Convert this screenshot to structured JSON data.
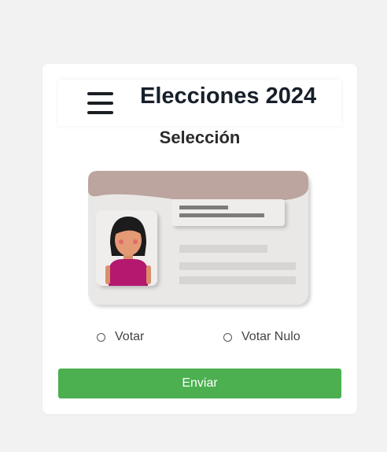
{
  "header": {
    "title": "Elecciones 2024",
    "menu_icon": "hamburger-menu-icon"
  },
  "main": {
    "subtitle": "Selección",
    "illustration": "id-card-illustration",
    "options": [
      {
        "label": "Votar",
        "selected": false
      },
      {
        "label": "Votar Nulo",
        "selected": false
      }
    ],
    "submit_label": "Enviar"
  },
  "colors": {
    "page_background": "#f2f2f2",
    "card_background": "#ffffff",
    "title_text": "#17202a",
    "submit_button": "#4caf50",
    "id_card_header": "#bba59e",
    "id_card_body": "#e9e8e6",
    "avatar_shirt": "#b5186f"
  }
}
